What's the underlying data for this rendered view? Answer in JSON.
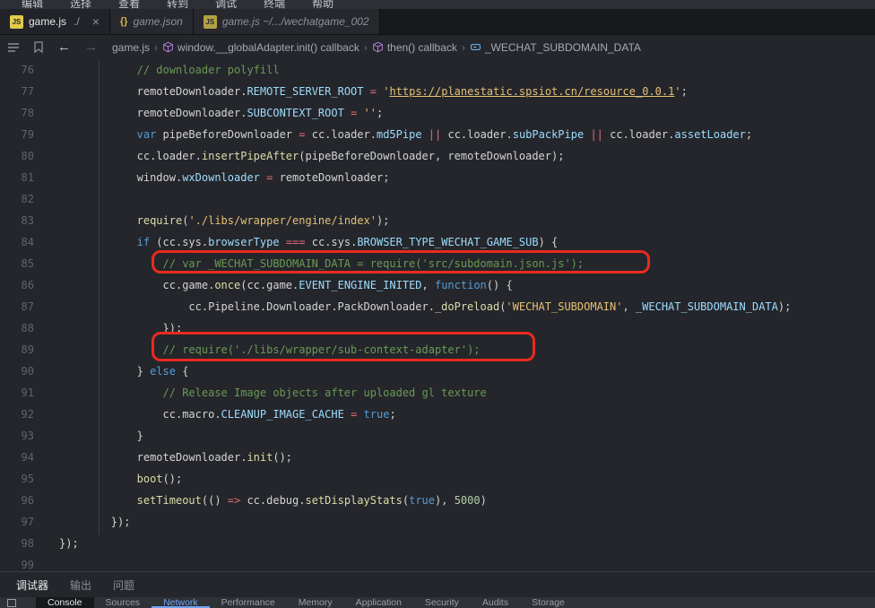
{
  "colors": {
    "plain": "#d4d4d4",
    "comment": "#6a9955",
    "string": "#e5c075",
    "keyword": "#569cd6",
    "function": "#dcdcaa",
    "property": "#9cdcfe",
    "operator": "#e06c75",
    "number": "#b5cea8",
    "annotation_red": "#ea2a1f",
    "devtools_blue": "#6ea3f2"
  },
  "icons": {
    "js_label": "JS",
    "json_label": "{}",
    "back_arrow": "←",
    "forward_arrow": "→"
  },
  "menubar": {
    "items": [
      "编辑",
      "选择",
      "查看",
      "转到",
      "调试",
      "终端",
      "帮助"
    ]
  },
  "tabs": [
    {
      "label": "game.js",
      "desc": "./",
      "close": "×",
      "icon": "js",
      "active": true
    },
    {
      "label": "game.json",
      "icon": "json",
      "active": false
    },
    {
      "label": "game.js ~/.../wechatgame_002",
      "icon": "js",
      "active": false
    }
  ],
  "breadcrumbs": {
    "separator": "›",
    "items": [
      {
        "label": "game.js",
        "icon": null
      },
      {
        "label": "window.__globalAdapter.init() callback",
        "icon": "cube"
      },
      {
        "label": "then() callback",
        "icon": "cube"
      },
      {
        "label": "_WECHAT_SUBDOMAIN_DATA",
        "icon": "field"
      }
    ]
  },
  "editor": {
    "lines": [
      {
        "n": 76,
        "ind": 12,
        "segs": [
          [
            "cm",
            "// downloader polyfill"
          ]
        ]
      },
      {
        "n": 77,
        "ind": 12,
        "segs": [
          [
            "pl",
            "remoteDownloader."
          ],
          [
            "pb",
            "REMOTE_SERVER_ROOT"
          ],
          [
            "pl",
            " "
          ],
          [
            "op",
            "="
          ],
          [
            "pl",
            " "
          ],
          [
            "st",
            "'"
          ],
          [
            "stu",
            "https://planestatic.spsiot.cn/resource_0.0.1"
          ],
          [
            "st",
            "'"
          ],
          [
            "pl",
            ";"
          ]
        ]
      },
      {
        "n": 78,
        "ind": 12,
        "segs": [
          [
            "pl",
            "remoteDownloader."
          ],
          [
            "pb",
            "SUBCONTEXT_ROOT"
          ],
          [
            "pl",
            " "
          ],
          [
            "op",
            "="
          ],
          [
            "pl",
            " "
          ],
          [
            "st",
            "''"
          ],
          [
            "pl",
            ";"
          ]
        ]
      },
      {
        "n": 79,
        "ind": 12,
        "segs": [
          [
            "kw",
            "var"
          ],
          [
            "pl",
            " pipeBeforeDownloader "
          ],
          [
            "op",
            "="
          ],
          [
            "pl",
            " cc.loader."
          ],
          [
            "pb",
            "md5Pipe"
          ],
          [
            "pl",
            " "
          ],
          [
            "op",
            "||"
          ],
          [
            "pl",
            " cc.loader."
          ],
          [
            "pb",
            "subPackPipe"
          ],
          [
            "pl",
            " "
          ],
          [
            "op",
            "||"
          ],
          [
            "pl",
            " cc.loader."
          ],
          [
            "pb",
            "assetLoader"
          ],
          [
            "pl",
            ";"
          ]
        ]
      },
      {
        "n": 80,
        "ind": 12,
        "segs": [
          [
            "pl",
            "cc.loader."
          ],
          [
            "fn",
            "insertPipeAfter"
          ],
          [
            "pl",
            "(pipeBeforeDownloader, remoteDownloader);"
          ]
        ]
      },
      {
        "n": 81,
        "ind": 12,
        "segs": [
          [
            "pl",
            "window."
          ],
          [
            "pb",
            "wxDownloader"
          ],
          [
            "pl",
            " "
          ],
          [
            "op",
            "="
          ],
          [
            "pl",
            " remoteDownloader;"
          ]
        ]
      },
      {
        "n": 82,
        "ind": 0,
        "segs": []
      },
      {
        "n": 83,
        "ind": 12,
        "segs": [
          [
            "fn",
            "require"
          ],
          [
            "pl",
            "("
          ],
          [
            "st",
            "'./libs/wrapper/engine/index'"
          ],
          [
            "pl",
            ");"
          ]
        ]
      },
      {
        "n": 84,
        "ind": 12,
        "segs": [
          [
            "kw",
            "if"
          ],
          [
            "pl",
            " (cc.sys."
          ],
          [
            "pb",
            "browserType"
          ],
          [
            "pl",
            " "
          ],
          [
            "op",
            "==="
          ],
          [
            "pl",
            " cc.sys."
          ],
          [
            "pb",
            "BROWSER_TYPE_WECHAT_GAME_SUB"
          ],
          [
            "pl",
            ") {"
          ]
        ]
      },
      {
        "n": 85,
        "ind": 16,
        "segs": [
          [
            "cm",
            "// var _WECHAT_SUBDOMAIN_DATA = require('src/subdomain.json.js');"
          ]
        ]
      },
      {
        "n": 86,
        "ind": 16,
        "segs": [
          [
            "pl",
            "cc.game."
          ],
          [
            "fn",
            "once"
          ],
          [
            "pl",
            "(cc.game."
          ],
          [
            "pb",
            "EVENT_ENGINE_INITED"
          ],
          [
            "pl",
            ", "
          ],
          [
            "kw",
            "function"
          ],
          [
            "pl",
            "() {"
          ]
        ]
      },
      {
        "n": 87,
        "ind": 20,
        "segs": [
          [
            "pl",
            "cc.Pipeline.Downloader.PackDownloader."
          ],
          [
            "fn",
            "_doPreload"
          ],
          [
            "pl",
            "("
          ],
          [
            "st",
            "'WECHAT_SUBDOMAIN'"
          ],
          [
            "pl",
            ", "
          ],
          [
            "pb",
            "_WECHAT_SUBDOMAIN_DATA"
          ],
          [
            "pl",
            ");"
          ]
        ]
      },
      {
        "n": 88,
        "ind": 16,
        "segs": [
          [
            "pl",
            "});"
          ]
        ]
      },
      {
        "n": 89,
        "ind": 16,
        "segs": [
          [
            "cm",
            "// require('./libs/wrapper/sub-context-adapter');"
          ]
        ]
      },
      {
        "n": 90,
        "ind": 12,
        "segs": [
          [
            "pl",
            "} "
          ],
          [
            "kw",
            "else"
          ],
          [
            "pl",
            " {"
          ]
        ]
      },
      {
        "n": 91,
        "ind": 16,
        "segs": [
          [
            "cm",
            "// Release Image objects after uploaded gl texture"
          ]
        ]
      },
      {
        "n": 92,
        "ind": 16,
        "segs": [
          [
            "pl",
            "cc.macro."
          ],
          [
            "pb",
            "CLEANUP_IMAGE_CACHE"
          ],
          [
            "pl",
            " "
          ],
          [
            "op",
            "="
          ],
          [
            "pl",
            " "
          ],
          [
            "kw",
            "true"
          ],
          [
            "pl",
            ";"
          ]
        ]
      },
      {
        "n": 93,
        "ind": 12,
        "segs": [
          [
            "pl",
            "}"
          ]
        ]
      },
      {
        "n": 94,
        "ind": 12,
        "segs": [
          [
            "pl",
            "remoteDownloader."
          ],
          [
            "fn",
            "init"
          ],
          [
            "pl",
            "();"
          ]
        ]
      },
      {
        "n": 95,
        "ind": 12,
        "segs": [
          [
            "fn",
            "boot"
          ],
          [
            "pl",
            "();"
          ]
        ]
      },
      {
        "n": 96,
        "ind": 12,
        "segs": [
          [
            "fn",
            "setTimeout"
          ],
          [
            "pl",
            "(() "
          ],
          [
            "op",
            "=>"
          ],
          [
            "pl",
            " cc.debug."
          ],
          [
            "fn",
            "setDisplayStats"
          ],
          [
            "pl",
            "("
          ],
          [
            "kw",
            "true"
          ],
          [
            "pl",
            "), "
          ],
          [
            "num",
            "5000"
          ],
          [
            "pl",
            ")"
          ]
        ]
      },
      {
        "n": 97,
        "ind": 8,
        "segs": [
          [
            "pl",
            "});"
          ]
        ]
      },
      {
        "n": 98,
        "ind": 0,
        "segs": [
          [
            "pl",
            "});"
          ]
        ]
      },
      {
        "n": 99,
        "ind": 0,
        "segs": []
      }
    ]
  },
  "panel": {
    "tabs": [
      "调试器",
      "输出",
      "问题"
    ]
  },
  "devtools": {
    "tabs": [
      "Console",
      "Sources",
      "Network",
      "Performance",
      "Memory",
      "Application",
      "Security",
      "Audits",
      "Storage"
    ]
  }
}
